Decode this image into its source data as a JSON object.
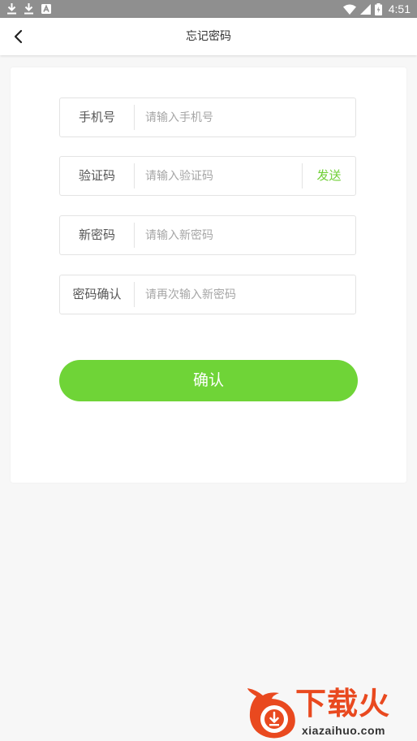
{
  "status_bar": {
    "time": "4:51",
    "background": "#8f8f8f",
    "left_icons": [
      "download-icon",
      "download-icon",
      "app-notification-icon"
    ],
    "right_icons": [
      "wifi-icon",
      "signal-icon",
      "battery-icon"
    ]
  },
  "header": {
    "title": "忘记密码",
    "back_icon": "chevron-left-icon"
  },
  "form": {
    "fields": [
      {
        "label": "手机号",
        "placeholder": "请输入手机号",
        "value": ""
      },
      {
        "label": "验证码",
        "placeholder": "请输入验证码",
        "value": "",
        "action_label": "发送"
      },
      {
        "label": "新密码",
        "placeholder": "请输入新密码",
        "value": ""
      },
      {
        "label": "密码确认",
        "placeholder": "请再次输入新密码",
        "value": ""
      }
    ],
    "confirm_label": "确认"
  },
  "watermark": {
    "brand": "下载火",
    "url": "xiazaihuo.com"
  },
  "colors": {
    "accent": "#6fd437",
    "send_text": "#6fcf35",
    "background": "#f7f7f7",
    "brand_red": "#e9491f"
  }
}
